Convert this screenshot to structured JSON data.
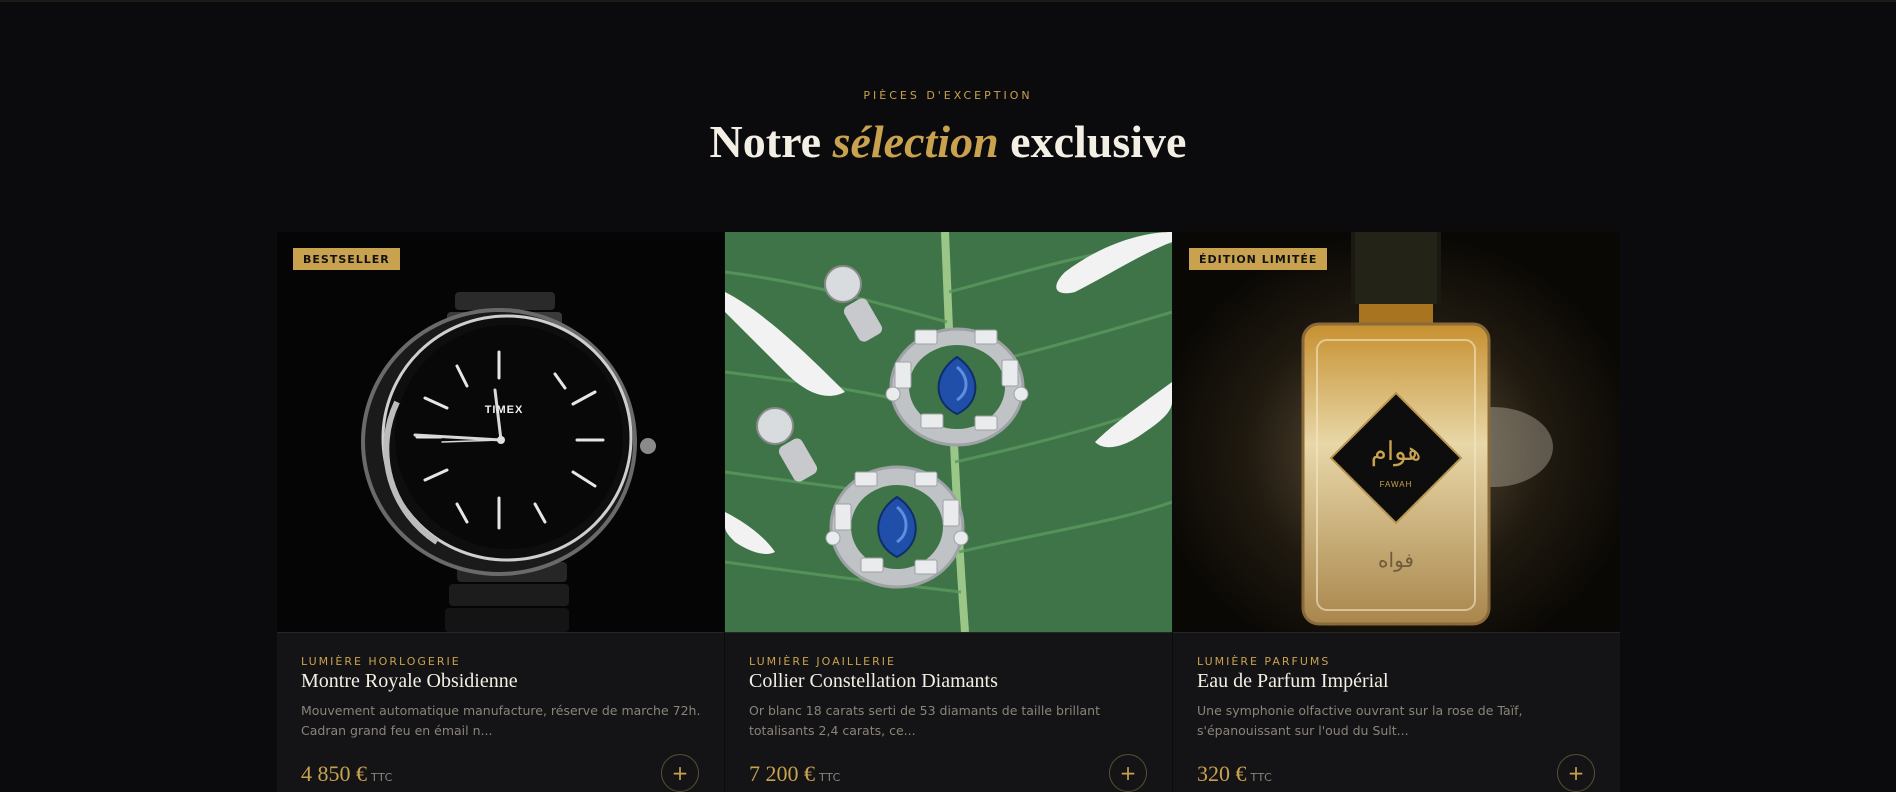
{
  "section": {
    "eyebrow": "PIÈCES D'EXCEPTION",
    "title_before": "Notre ",
    "title_highlight": "sélection",
    "title_after": " exclusive"
  },
  "products": [
    {
      "badge": "BESTSELLER",
      "brand": "LUMIÈRE HORLOGERIE",
      "name": "Montre Royale Obsidienne",
      "description": "Mouvement automatique manufacture, réserve de marche 72h. Cadran grand feu en émail n...",
      "price": "4 850 €",
      "tax_label": "TTC",
      "image": "black-watch-image",
      "dial_text": "TIMEX",
      "add_label": "+"
    },
    {
      "badge": "",
      "brand": "LUMIÈRE JOAILLERIE",
      "name": "Collier Constellation Diamants",
      "description": "Or blanc 18 carats serti de 53 diamants de taille brillant totalisants 2,4 carats, ce...",
      "price": "7 200 €",
      "tax_label": "TTC",
      "image": "sapphire-earrings-on-leaf-image",
      "add_label": "+"
    },
    {
      "badge": "ÉDITION LIMITÉE",
      "brand": "LUMIÈRE PARFUMS",
      "name": "Eau de Parfum Impérial",
      "description": "Une symphonie olfactive ouvrant sur la rose de Taïf, s'épanouissant sur l'oud du Sult...",
      "price": "320 €",
      "tax_label": "TTC",
      "image": "perfume-bottle-image",
      "label_text": "FAWAH",
      "add_label": "+"
    }
  ],
  "colors": {
    "background": "#0b0b0d",
    "card": "#141416",
    "accent_gold": "#c9a24f",
    "text": "#f4efe4",
    "muted": "#8a8478"
  }
}
